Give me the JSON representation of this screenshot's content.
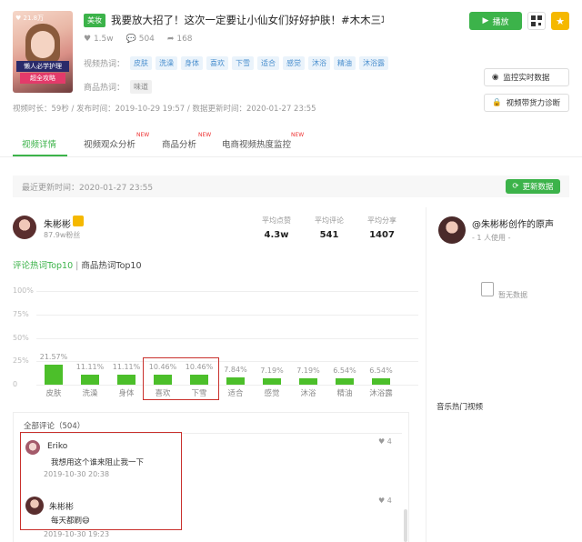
{
  "video": {
    "thumb_likes": "♥ 21.8万",
    "thumb_caption_1": "懒人必学护理",
    "thumb_caption_2": "超全攻略",
    "badge": "美妆",
    "title": "我要放大招了！这次一定要让小仙女们好好护肤！#木木三攻...",
    "likes": "1.5w",
    "comments": "504",
    "shares": "168",
    "hot_words_label": "视频热词：",
    "hot_words": [
      "皮肤",
      "洗澡",
      "身体",
      "喜欢",
      "下雪",
      "适合",
      "感觉",
      "沐浴",
      "精油",
      "沐浴露"
    ],
    "product_words_label": "商品热词：",
    "product_words": [
      "味道"
    ],
    "meta": "视频时长：59秒 / 发布时间：2019-10-29 19:57 / 数据更新时间：2020-01-27 23:55",
    "play_label": "播放",
    "monitor_label": "监控实时数据",
    "diagnose_label": "视频带货力诊断"
  },
  "tabs": [
    {
      "label": "视频详情",
      "new": ""
    },
    {
      "label": "视频观众分析",
      "new": "NEW"
    },
    {
      "label": "商品分析",
      "new": "NEW"
    },
    {
      "label": "电商视频热度监控",
      "new": "NEW"
    }
  ],
  "update_bar": {
    "text": "最近更新时间：2020-01-27 23:55",
    "button": "更新数据"
  },
  "author": {
    "name": "朱彬彬",
    "fans": "87.9w粉丝",
    "stats": [
      {
        "label": "平均点赞",
        "value": "4.3w"
      },
      {
        "label": "平均评论",
        "value": "541"
      },
      {
        "label": "平均分享",
        "value": "1407"
      }
    ]
  },
  "hot_tabs": {
    "active": "评论热词Top10",
    "sep": "|",
    "other": "商品热词Top10"
  },
  "chart_data": {
    "type": "bar",
    "categories": [
      "皮肤",
      "洗澡",
      "身体",
      "喜欢",
      "下雪",
      "适合",
      "感觉",
      "沐浴",
      "精油",
      "沐浴露"
    ],
    "values": [
      21.57,
      11.11,
      11.11,
      10.46,
      10.46,
      7.84,
      7.19,
      7.19,
      6.54,
      6.54
    ],
    "value_labels": [
      "21.57%",
      "11.11%",
      "11.11%",
      "10.46%",
      "10.46%",
      "7.84%",
      "7.19%",
      "7.19%",
      "6.54%",
      "6.54%"
    ],
    "yticks": [
      "100%",
      "75%",
      "50%",
      "25%",
      "0"
    ],
    "ylim": [
      0,
      100
    ],
    "color": "#4cbf2a"
  },
  "comments": {
    "header": "全部评论（504）",
    "items": [
      {
        "user": "Eriko",
        "text": "我想用这个谁来阻止我一下",
        "time": "2019-10-30 20:38",
        "likes": "4"
      },
      {
        "user": "朱彬彬",
        "text": "每天都刷",
        "emoji": "😄",
        "time": "2019-10-30 19:23",
        "likes": "4"
      }
    ]
  },
  "sound": {
    "title": "@朱彬彬创作的原声",
    "users": "- 1 人使用 -",
    "empty": "暂无数据",
    "music_title": "音乐热门视频"
  },
  "colors": {
    "accent": "#3cb34a",
    "highlight_box": "#c9302c"
  }
}
